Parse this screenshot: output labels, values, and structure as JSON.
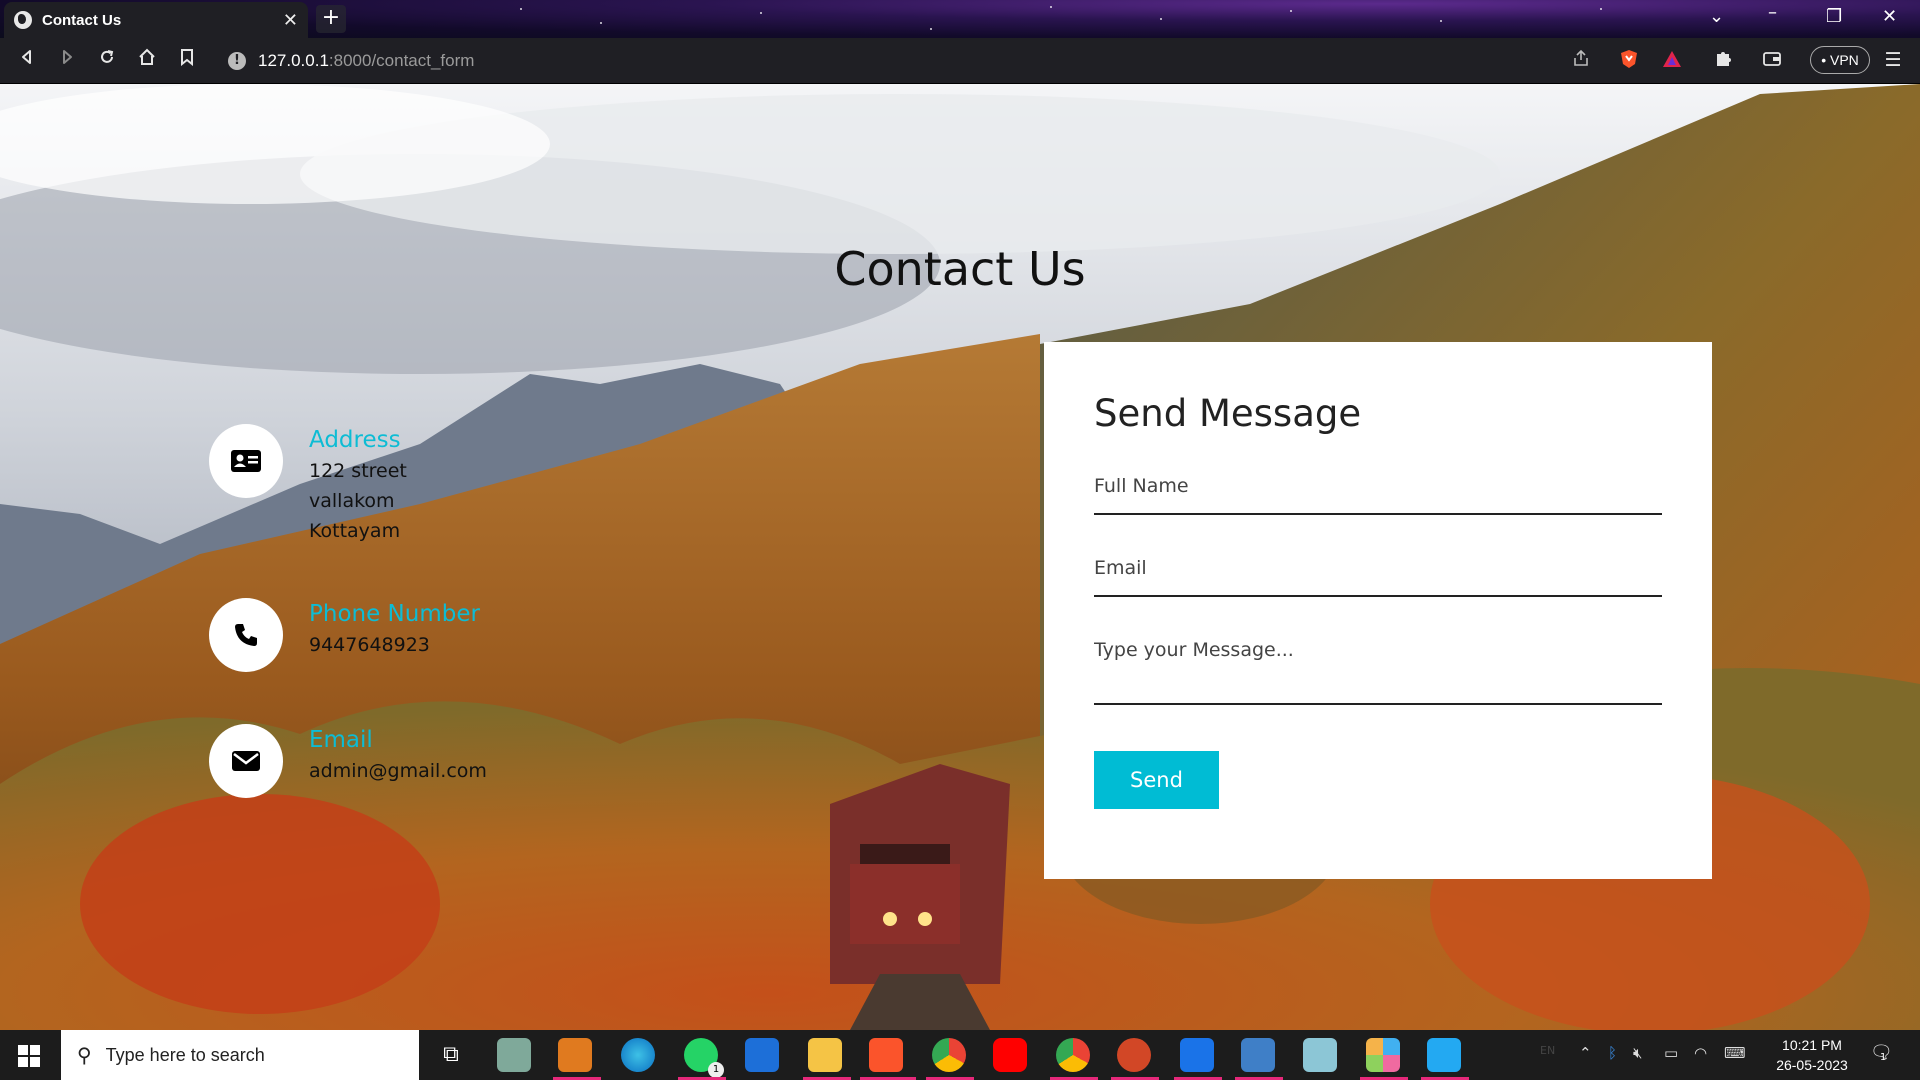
{
  "browser": {
    "tab_title": "Contact Us",
    "tab_close": "✕",
    "new_tab": "+",
    "url_host": "127.0.0.1",
    "url_rest": ":8000/contact_form",
    "vpn_label": "• VPN"
  },
  "page": {
    "title": "Contact Us",
    "contact_items": [
      {
        "heading": "Address",
        "lines": [
          "122 street",
          "vallakom",
          "Kottayam"
        ],
        "icon": "address-card-icon"
      },
      {
        "heading": "Phone Number",
        "lines": [
          "9447648923"
        ],
        "icon": "phone-icon"
      },
      {
        "heading": "Email",
        "lines": [
          "admin@gmail.com"
        ],
        "icon": "envelope-icon"
      }
    ],
    "form": {
      "heading": "Send Message",
      "name_placeholder": "Full Name",
      "email_placeholder": "Email",
      "message_placeholder": "Type your Message...",
      "send_label": "Send"
    },
    "colors": {
      "accent": "#00bcd4",
      "heading_cyan": "#0dbcd4"
    }
  },
  "taskbar": {
    "search_placeholder": "Type here to search",
    "language": "EN",
    "time": "10:21 PM",
    "date": "26-05-2023",
    "notification_count": "1",
    "whatsapp_badge": "1"
  }
}
